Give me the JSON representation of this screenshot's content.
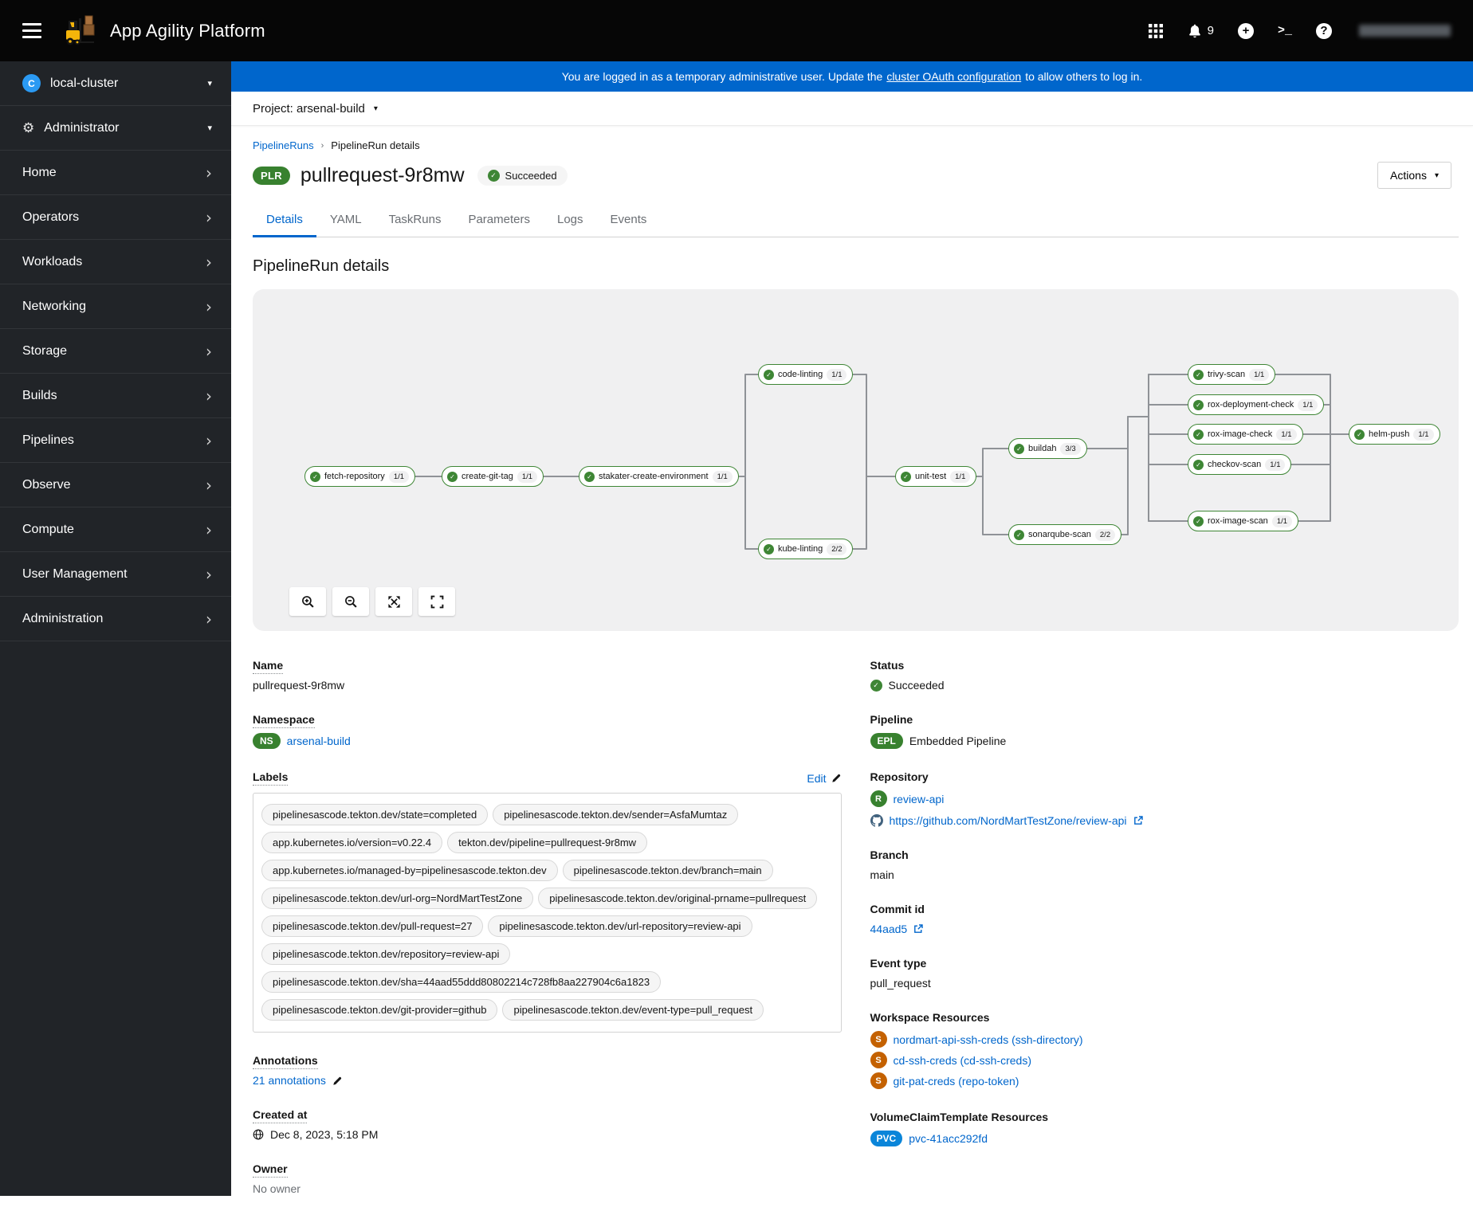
{
  "masthead": {
    "brand": "App Agility Platform",
    "notification_count": "9"
  },
  "banner": {
    "before": "You are logged in as a temporary administrative user. Update the",
    "link": "cluster OAuth configuration",
    "after": "to allow others to log in."
  },
  "project_bar": {
    "label": "Project: arsenal-build"
  },
  "sidebar": {
    "cluster_icon_letter": "C",
    "cluster_label": "local-cluster",
    "perspective_label": "Administrator",
    "items": [
      {
        "label": "Home"
      },
      {
        "label": "Operators"
      },
      {
        "label": "Workloads"
      },
      {
        "label": "Networking"
      },
      {
        "label": "Storage"
      },
      {
        "label": "Builds"
      },
      {
        "label": "Pipelines"
      },
      {
        "label": "Observe"
      },
      {
        "label": "Compute"
      },
      {
        "label": "User Management"
      },
      {
        "label": "Administration"
      }
    ]
  },
  "breadcrumb": {
    "link": "PipelineRuns",
    "current": "PipelineRun details"
  },
  "header": {
    "resource_badge": "PLR",
    "title": "pullrequest-9r8mw",
    "status_badge": "Succeeded",
    "actions_label": "Actions"
  },
  "tabs": [
    {
      "label": "Details",
      "active": true
    },
    {
      "label": "YAML",
      "active": false
    },
    {
      "label": "TaskRuns",
      "active": false
    },
    {
      "label": "Parameters",
      "active": false
    },
    {
      "label": "Logs",
      "active": false
    },
    {
      "label": "Events",
      "active": false
    }
  ],
  "section_heading": "PipelineRun details",
  "pipeline_graph": {
    "tasks": [
      {
        "id": "fetch-repository",
        "name": "fetch-repository",
        "runs": "1/1"
      },
      {
        "id": "create-git-tag",
        "name": "create-git-tag",
        "runs": "1/1"
      },
      {
        "id": "stakater-create-environment",
        "name": "stakater-create-environment",
        "runs": "1/1"
      },
      {
        "id": "code-linting",
        "name": "code-linting",
        "runs": "1/1"
      },
      {
        "id": "kube-linting",
        "name": "kube-linting",
        "runs": "2/2"
      },
      {
        "id": "unit-test",
        "name": "unit-test",
        "runs": "1/1"
      },
      {
        "id": "buildah",
        "name": "buildah",
        "runs": "3/3"
      },
      {
        "id": "sonarqube-scan",
        "name": "sonarqube-scan",
        "runs": "2/2"
      },
      {
        "id": "trivy-scan",
        "name": "trivy-scan",
        "runs": "1/1"
      },
      {
        "id": "rox-deployment-check",
        "name": "rox-deployment-check",
        "runs": "1/1"
      },
      {
        "id": "rox-image-check",
        "name": "rox-image-check",
        "runs": "1/1"
      },
      {
        "id": "checkov-scan",
        "name": "checkov-scan",
        "runs": "1/1"
      },
      {
        "id": "rox-image-scan",
        "name": "rox-image-scan",
        "runs": "1/1"
      },
      {
        "id": "helm-push",
        "name": "helm-push",
        "runs": "1/1"
      }
    ]
  },
  "details": {
    "name": {
      "label": "Name",
      "value": "pullrequest-9r8mw"
    },
    "namespace": {
      "label": "Namespace",
      "badge": "NS",
      "value": "arsenal-build"
    },
    "labels": {
      "label": "Labels",
      "edit_label": "Edit",
      "chips": [
        "pipelinesascode.tekton.dev/state=completed",
        "pipelinesascode.tekton.dev/sender=AsfaMumtaz",
        "app.kubernetes.io/version=v0.22.4",
        "tekton.dev/pipeline=pullrequest-9r8mw",
        "app.kubernetes.io/managed-by=pipelinesascode.tekton.dev",
        "pipelinesascode.tekton.dev/branch=main",
        "pipelinesascode.tekton.dev/url-org=NordMartTestZone",
        "pipelinesascode.tekton.dev/original-prname=pullrequest",
        "pipelinesascode.tekton.dev/pull-request=27",
        "pipelinesascode.tekton.dev/url-repository=review-api",
        "pipelinesascode.tekton.dev/repository=review-api",
        "pipelinesascode.tekton.dev/sha=44aad55ddd80802214c728fb8aa227904c6a1823",
        "pipelinesascode.tekton.dev/git-provider=github",
        "pipelinesascode.tekton.dev/event-type=pull_request"
      ]
    },
    "annotations": {
      "label": "Annotations",
      "value": "21 annotations"
    },
    "created_at": {
      "label": "Created at",
      "value": "Dec 8, 2023, 5:18 PM"
    },
    "owner": {
      "label": "Owner",
      "value": "No owner"
    },
    "status": {
      "label": "Status",
      "value": "Succeeded"
    },
    "pipeline": {
      "label": "Pipeline",
      "badge": "EPL",
      "value": "Embedded Pipeline"
    },
    "repository": {
      "label": "Repository",
      "badge": "R",
      "name": "review-api",
      "url": "https://github.com/NordMartTestZone/review-api"
    },
    "branch": {
      "label": "Branch",
      "value": "main"
    },
    "commit": {
      "label": "Commit id",
      "value": "44aad5"
    },
    "event_type": {
      "label": "Event type",
      "value": "pull_request"
    },
    "workspaces": {
      "label": "Workspace Resources",
      "badge": "S",
      "items": [
        "nordmart-api-ssh-creds (ssh-directory)",
        "cd-ssh-creds (cd-ssh-creds)",
        "git-pat-creds (repo-token)"
      ]
    },
    "volume_claims": {
      "label": "VolumeClaimTemplate Resources",
      "badge": "PVC",
      "value": "pvc-41acc292fd"
    }
  },
  "colors": {
    "accent": "#0066cc",
    "success": "#3e8635",
    "badge_green": "#38812f",
    "badge_orange": "#c46100",
    "badge_blue": "#0a85d9",
    "edge_gray": "#8f9297"
  }
}
